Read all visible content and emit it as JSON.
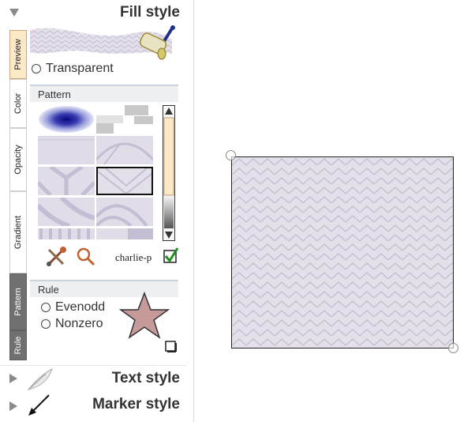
{
  "fill_style": {
    "header": "Fill style",
    "transparent_label": "Transparent",
    "tabs": [
      "Preview",
      "Color",
      "Opacity",
      "Gradient",
      "Pattern",
      "Rule"
    ],
    "pattern": {
      "heading": "Pattern",
      "selected_name": "charlie-p"
    },
    "rule": {
      "heading": "Rule",
      "options": [
        "Evenodd",
        "Nonzero"
      ]
    }
  },
  "text_style": {
    "header": "Text style"
  },
  "marker_style": {
    "header": "Marker style"
  },
  "colors": {
    "accent_tab": "#fde9c8",
    "pattern_fill": "#e3e0ea",
    "pattern_line": "#c4bdd3",
    "star_fill": "#c79a9a",
    "check_green": "#1f8f1f"
  },
  "icons": [
    "paint-roller-icon",
    "eyedropper-icon",
    "magnifier-icon",
    "checkmark-icon",
    "feather-icon",
    "arrow-icon",
    "star-icon"
  ]
}
